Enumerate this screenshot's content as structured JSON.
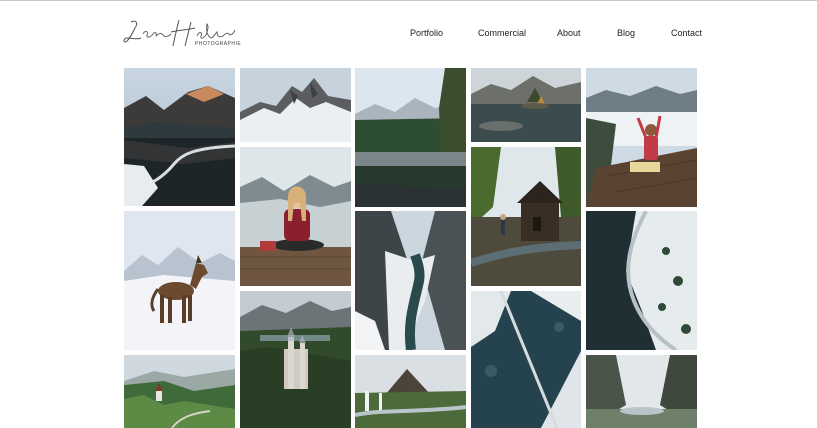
{
  "brand": {
    "name": "Jan Holub",
    "tagline": "PHOTOGRAPHIE"
  },
  "nav": {
    "items": [
      {
        "label": "Portfolio"
      },
      {
        "label": "Commercial"
      },
      {
        "label": "About"
      },
      {
        "label": "Blog"
      },
      {
        "label": "Contact"
      }
    ]
  },
  "gallery": {
    "photos": [
      {
        "subject": "mountain lake reflection at sunrise"
      },
      {
        "subject": "snowy mountain peak"
      },
      {
        "subject": "forest lake reflection with mist"
      },
      {
        "subject": "alpine lake with small island"
      },
      {
        "subject": "woman on wooden deck above clouds"
      },
      {
        "subject": "woman in red sweater sitting on dock"
      },
      {
        "subject": "wooden hut by forest stream"
      },
      {
        "subject": "dog in snow"
      },
      {
        "subject": "aerial view of snowy river"
      },
      {
        "subject": "snowy valley with river"
      },
      {
        "subject": "aerial winding road through snow"
      },
      {
        "subject": "aerial frozen lake with road"
      },
      {
        "subject": "castle among hills"
      },
      {
        "subject": "waterfall with pointed mountain"
      },
      {
        "subject": "green meadow with church"
      },
      {
        "subject": "misty valley lake"
      }
    ]
  }
}
